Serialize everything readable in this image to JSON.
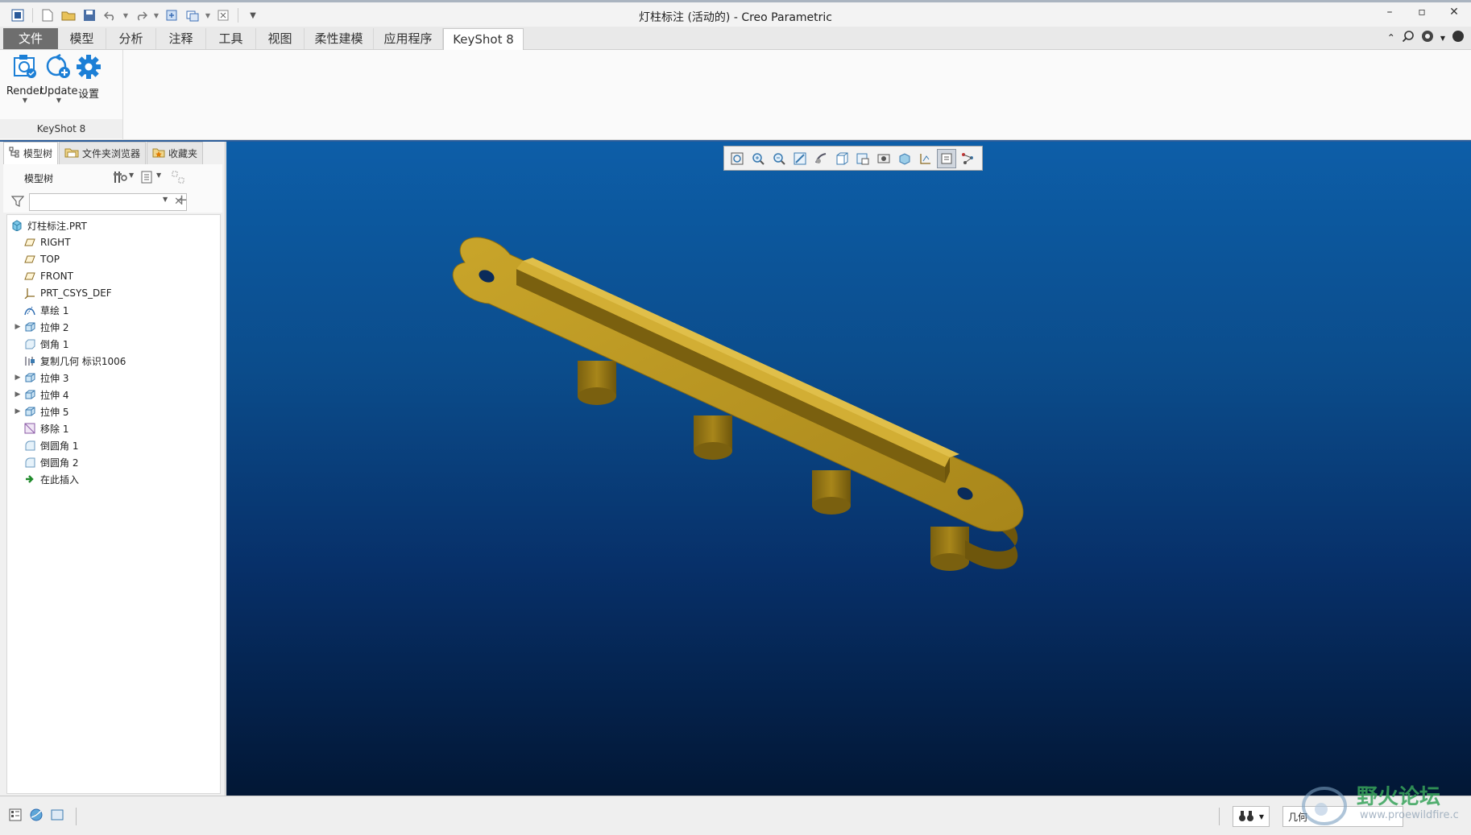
{
  "window": {
    "title": "灯柱标注 (活动的) - Creo Parametric"
  },
  "tabs": [
    {
      "label": "文件"
    },
    {
      "label": "模型"
    },
    {
      "label": "分析"
    },
    {
      "label": "注释"
    },
    {
      "label": "工具"
    },
    {
      "label": "视图"
    },
    {
      "label": "柔性建模"
    },
    {
      "label": "应用程序"
    },
    {
      "label": "KeyShot 8"
    }
  ],
  "ribbon": {
    "render_label": "Render",
    "update_label": "Update",
    "settings_label": "设置",
    "group_label": "KeyShot 8"
  },
  "panel": {
    "tabs": [
      {
        "label": "模型树"
      },
      {
        "label": "文件夹浏览器"
      },
      {
        "label": "收藏夹"
      }
    ],
    "tree_title": "模型树",
    "filter_placeholder": ""
  },
  "tree": {
    "root": "灯柱标注.PRT",
    "items": [
      {
        "label": "RIGHT",
        "icon": "datum-plane-icon"
      },
      {
        "label": "TOP",
        "icon": "datum-plane-icon"
      },
      {
        "label": "FRONT",
        "icon": "datum-plane-icon"
      },
      {
        "label": "PRT_CSYS_DEF",
        "icon": "coordinate-system-icon"
      },
      {
        "label": "草绘 1",
        "icon": "sketch-icon"
      },
      {
        "label": "拉伸 2",
        "icon": "extrude-icon"
      },
      {
        "label": "倒角 1",
        "icon": "chamfer-icon"
      },
      {
        "label": "复制几何 标识1006",
        "icon": "copy-geometry-icon"
      },
      {
        "label": "拉伸 3",
        "icon": "extrude-icon"
      },
      {
        "label": "拉伸 4",
        "icon": "extrude-icon"
      },
      {
        "label": "拉伸 5",
        "icon": "extrude-icon"
      },
      {
        "label": "移除 1",
        "icon": "remove-icon"
      },
      {
        "label": "倒圆角 1",
        "icon": "round-icon"
      },
      {
        "label": "倒圆角 2",
        "icon": "round-icon"
      },
      {
        "label": "在此插入",
        "icon": "insert-here-icon"
      }
    ]
  },
  "status": {
    "filter_label": "几何"
  },
  "watermark": {
    "cn": "野火论坛",
    "en": "www.proewildfire.c"
  },
  "colors": {
    "accent_blue": "#1c7fd6",
    "part_gold": "#a8861a",
    "viewport_top": "#0d5ea8",
    "viewport_bottom": "#021735"
  }
}
